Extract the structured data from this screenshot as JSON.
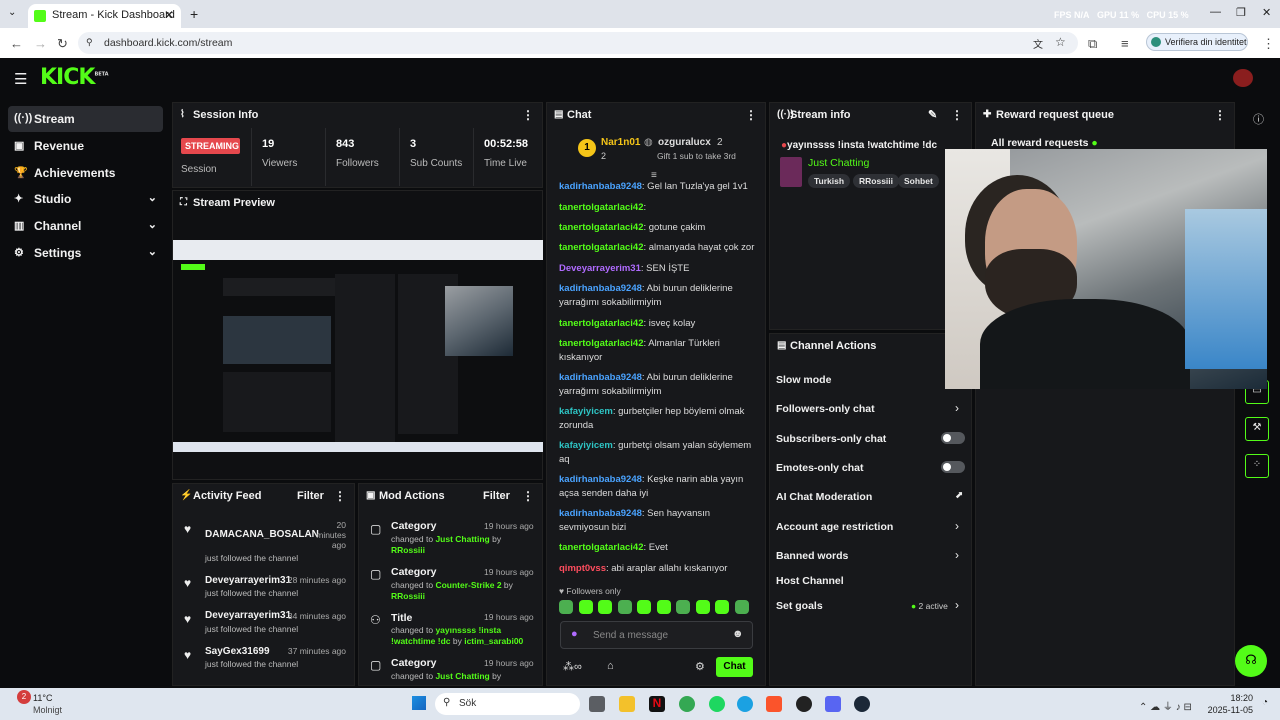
{
  "browser": {
    "tab_title": "Stream - Kick Dashboard",
    "url": "dashboard.kick.com/stream",
    "profile": "Verifiera din identitet",
    "overlay": {
      "fps_label": "FPS",
      "fps": "N/A",
      "gpu_label": "GPU",
      "gpu": "11 %",
      "cpu_label": "CPU",
      "cpu": "15 %"
    }
  },
  "logo": {
    "text": "KICK",
    "beta": "BETA"
  },
  "sidebar": {
    "items": [
      {
        "label": "Stream",
        "icon": "((·))"
      },
      {
        "label": "Revenue",
        "icon": "▣"
      },
      {
        "label": "Achievements",
        "icon": "🏆"
      },
      {
        "label": "Studio",
        "icon": "✦"
      },
      {
        "label": "Channel",
        "icon": "▥"
      },
      {
        "label": "Settings",
        "icon": "⚙"
      }
    ]
  },
  "session": {
    "title": "Session Info",
    "badge": "STREAMING",
    "session_label": "Session",
    "viewers": "19",
    "viewers_label": "Viewers",
    "followers": "843",
    "followers_label": "Followers",
    "subs": "3",
    "subs_label": "Sub Counts",
    "time": "00:52:58",
    "time_label": "Time Live"
  },
  "preview": {
    "title": "Stream Preview"
  },
  "chat": {
    "title": "Chat",
    "pin": {
      "user1": "Nar1n01",
      "count1": "2",
      "user2": "ozguralucx",
      "count2": "2",
      "sub_note": "Gift 1 sub to take 3rd",
      "rank": "1"
    },
    "messages": [
      {
        "user": "kadirhanbaba9248",
        "text": ": Gel lan Tuzla'ya gel 1v1",
        "color": "#4aa3ff"
      },
      {
        "user": "tanertolgatarlaci42",
        "text": ":",
        "color": "#53fc18"
      },
      {
        "user": "tanertolgatarlaci42",
        "text": ": gotune çakim",
        "color": "#53fc18"
      },
      {
        "user": "tanertolgatarlaci42",
        "text": ": almanyada hayat çok zor",
        "color": "#53fc18"
      },
      {
        "user": "Deveyarrayerim31",
        "text": ": SEN İŞTE",
        "color": "#b06bff"
      },
      {
        "user": "kadirhanbaba9248",
        "text": ": Abi burun deliklerine yarrağımı sokabilirmiyim",
        "color": "#4aa3ff"
      },
      {
        "user": "tanertolgatarlaci42",
        "text": ": isveç kolay",
        "color": "#53fc18"
      },
      {
        "user": "tanertolgatarlaci42",
        "text": ": Almanlar Türkleri kıskanıyor",
        "color": "#53fc18"
      },
      {
        "user": "kadirhanbaba9248",
        "text": ": Abi burun deliklerine yarrağımı sokabilirmiyim",
        "color": "#4aa3ff"
      },
      {
        "user": "kafayiyicem",
        "text": ": gurbetçiler hep böylemi olmak zorunda",
        "color": "#2ec4c4"
      },
      {
        "user": "kafayiyicem",
        "text": ": gurbetçi olsam yalan söylemem aq",
        "color": "#2ec4c4"
      },
      {
        "user": "kadirhanbaba9248",
        "text": ": Keşke narin abla yayın açsa senden daha iyi",
        "color": "#4aa3ff"
      },
      {
        "user": "kadirhanbaba9248",
        "text": ": Sen hayvansın sevmiyosun bizi",
        "color": "#4aa3ff"
      },
      {
        "user": "tanertolgatarlaci42",
        "text": ": Evet",
        "color": "#53fc18"
      },
      {
        "user": "qimpt0vss",
        "text": ": abi araplar allahı kıskanıyor",
        "color": "#ff4d5e"
      }
    ],
    "followers_only": "Followers only",
    "placeholder": "Send a message",
    "send": "Chat"
  },
  "stream_info": {
    "title": "Stream info",
    "stream_title": "yayınssss !insta !watchtime !dc",
    "category": "Just Chatting",
    "tags": [
      "Turkish",
      "RRossiii",
      "Sohbet"
    ]
  },
  "channel_actions": {
    "title": "Channel Actions",
    "items": [
      "Slow mode",
      "Followers-only chat",
      "Subscribers-only chat",
      "Emotes-only chat",
      "AI Chat Moderation",
      "Account age restriction",
      "Banned words",
      "Host Channel",
      "Set goals"
    ],
    "goals_status": "2 active"
  },
  "reward": {
    "title": "Reward request queue",
    "all": "All reward requests"
  },
  "activity": {
    "title": "Activity Feed",
    "filter": "Filter",
    "items": [
      {
        "name": "DAMACANA_BOSALAN",
        "time": "20 minutes ago",
        "sub": "just followed the channel"
      },
      {
        "name": "Deveyarrayerim31",
        "time": "28 minutes ago",
        "sub": "just followed the channel"
      },
      {
        "name": "Deveyarrayerim31",
        "time": "34 minutes ago",
        "sub": "just followed the channel"
      },
      {
        "name": "SayGex31699",
        "time": "37 minutes ago",
        "sub": "just followed the channel"
      }
    ]
  },
  "mod": {
    "title": "Mod Actions",
    "filter": "Filter",
    "items": [
      {
        "title": "Category",
        "time": "19 hours ago",
        "pre": "changed to ",
        "val": "Just Chatting",
        "by": " by ",
        "who": "RRossiii"
      },
      {
        "title": "Category",
        "time": "19 hours ago",
        "pre": "changed to ",
        "val": "Counter-Strike 2",
        "by": " by ",
        "who": "RRossiii"
      },
      {
        "title": "Title",
        "time": "19 hours ago",
        "pre": "changed to ",
        "val": "yayınssss !insta !watchtime !dc",
        "by": " by ",
        "who": "ictim_sarabi00"
      },
      {
        "title": "Category",
        "time": "19 hours ago",
        "pre": "changed to ",
        "val": "Just Chatting",
        "by": " by ",
        "who": ""
      }
    ]
  },
  "taskbar": {
    "weather_temp": "11°C",
    "weather_desc": "Molnigt",
    "search": "Sök",
    "time": "18:20",
    "date": "2025-11-05",
    "badge": "2"
  }
}
